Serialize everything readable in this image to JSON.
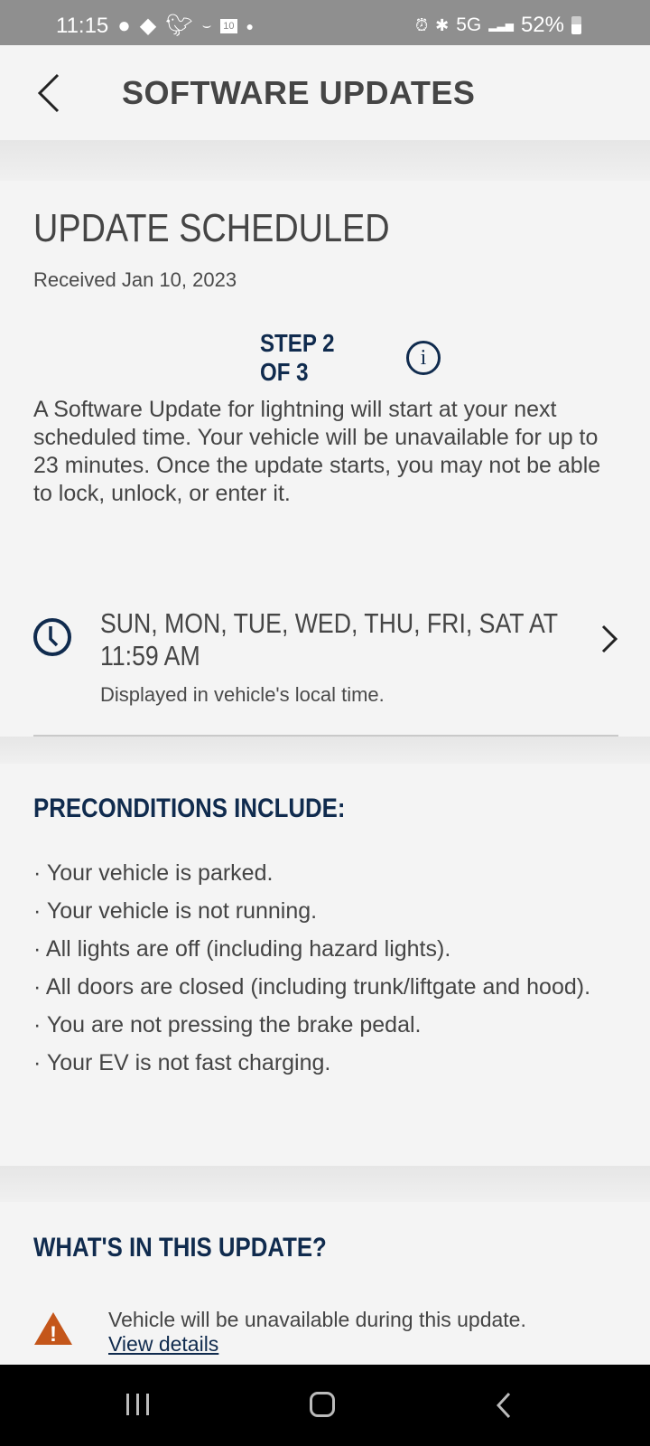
{
  "status_bar": {
    "time": "11:15",
    "notification_icons": [
      "bunny-icon",
      "map-icon",
      "twitter-icon",
      "amazon-icon",
      "calendar-icon"
    ],
    "calendar_day": "10",
    "network": "5G",
    "battery": "52%"
  },
  "header": {
    "title": "SOFTWARE UPDATES"
  },
  "update": {
    "title": "UPDATE SCHEDULED",
    "received": "Received Jan 10, 2023",
    "step": "STEP 2 OF 3",
    "description": "A Software Update for lightning  will start at your next scheduled time. Your vehicle will be unavailable for up to 23 minutes. Once the update starts, you may not be able to lock, unlock, or enter it.",
    "schedule": "SUN, MON, TUE, WED, THU, FRI, SAT AT 11:59 AM",
    "schedule_note": "Displayed in vehicle's local time."
  },
  "preconditions": {
    "title": "PRECONDITIONS INCLUDE:",
    "items": [
      "· Your vehicle is parked.",
      "· Your vehicle is not running.",
      "· All lights are off (including hazard lights).",
      "· All doors are closed (including trunk/liftgate and hood).",
      "· You are not pressing the brake pedal.",
      "· Your EV is not fast charging."
    ]
  },
  "whats_new": {
    "title": "WHAT'S IN THIS UPDATE?",
    "warning": "Vehicle will be unavailable during this update.",
    "link": "View details"
  },
  "colors": {
    "navy": "#102b4e",
    "warning": "#c4561a"
  }
}
